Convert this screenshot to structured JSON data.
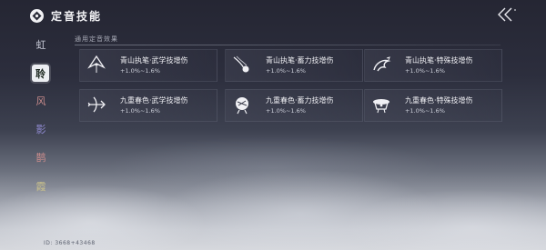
{
  "header": {
    "title": "定音技能",
    "back_icon": "double-chevron-left-icon"
  },
  "sidebar": {
    "items": [
      {
        "label": "虹",
        "active": false,
        "color": "#c9cbd8"
      },
      {
        "label": "聆",
        "active": true,
        "color": "#1f2a23"
      },
      {
        "label": "风",
        "active": false,
        "color": "#c98c8c"
      },
      {
        "label": "影",
        "active": false,
        "color": "#8f8ad0"
      },
      {
        "label": "鹊",
        "active": false,
        "color": "#c98c8c"
      },
      {
        "label": "霞",
        "active": false,
        "color": "#c9c08c"
      }
    ]
  },
  "panel": {
    "caption": "通用定音效果",
    "cards": [
      {
        "name": "青山执笔·武学技增伤",
        "bonus": "+1.0%~1.6%",
        "icon": "pen-brush-icon"
      },
      {
        "name": "青山执笔·蓄力技增伤",
        "bonus": "+1.0%~1.6%",
        "icon": "comet-icon"
      },
      {
        "name": "青山执笔·特殊技增伤",
        "bonus": "+1.0%~1.6%",
        "icon": "dragon-icon"
      },
      {
        "name": "九重春色·武学技增伤",
        "bonus": "+1.0%~1.6%",
        "icon": "crossbow-icon"
      },
      {
        "name": "九重春色·蓄力技增伤",
        "bonus": "+1.0%~1.6%",
        "icon": "shield-orb-icon"
      },
      {
        "name": "九重春色·特殊技增伤",
        "bonus": "+1.0%~1.6%",
        "icon": "drum-icon"
      }
    ]
  },
  "footer": {
    "uid": "ID: 3668+43468"
  }
}
